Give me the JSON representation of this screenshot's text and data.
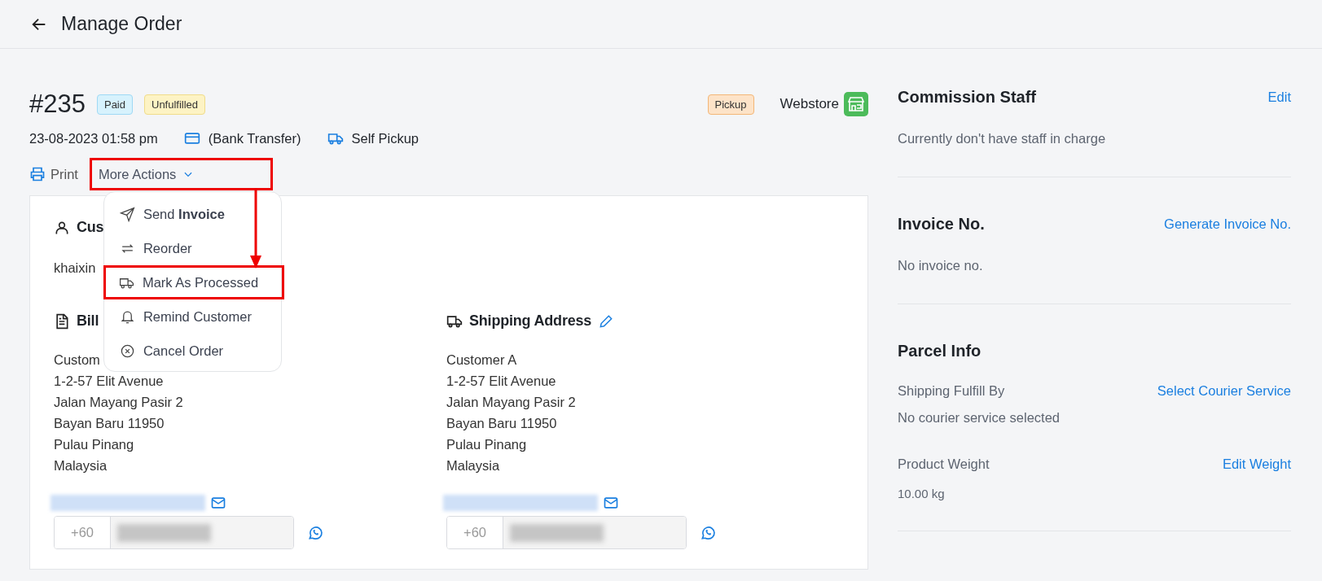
{
  "header": {
    "title": "Manage Order"
  },
  "order": {
    "number": "#235",
    "badges": [
      {
        "label": "Paid",
        "kind": "paid"
      },
      {
        "label": "Unfulfilled",
        "kind": "unfulfilled"
      }
    ],
    "date": "23-08-2023 01:58 pm",
    "payment": "(Bank Transfer)",
    "delivery": "Self Pickup",
    "method_badge": {
      "label": "Pickup",
      "kind": "pickup"
    },
    "channel": "Webstore"
  },
  "actions": {
    "print": "Print",
    "more": {
      "label": "More Actions",
      "expanded": true,
      "highlighted": true
    },
    "menu": [
      {
        "label": "Send **Invoice**",
        "highlighted": false
      },
      {
        "label": "Reorder",
        "highlighted": false
      },
      {
        "label": "Mark As Processed",
        "highlighted": true
      },
      {
        "label": "Remind Customer",
        "highlighted": false
      },
      {
        "label": "Cancel Order",
        "highlighted": false
      }
    ]
  },
  "customer": {
    "title": "Cus",
    "name": "khaixin"
  },
  "billing": {
    "title": "Bill",
    "lines": [
      "Custom",
      "1-2-57 Elit Avenue",
      "Jalan Mayang Pasir 2",
      "Bayan Baru 11950",
      "Pulau Pinang",
      "Malaysia"
    ],
    "phone_code": "+60"
  },
  "shipping": {
    "title": "Shipping Address",
    "lines": [
      "Customer A",
      "1-2-57 Elit Avenue",
      "Jalan Mayang Pasir 2",
      "Bayan Baru 11950",
      "Pulau Pinang",
      "Malaysia"
    ],
    "phone_code": "+60",
    "editable": true
  },
  "side": [
    {
      "title": "Commission Staff",
      "action": "Edit",
      "items": [
        {
          "kind": "note",
          "text": "Currently don't have staff in charge"
        }
      ]
    },
    {
      "title": "Invoice No.",
      "action": "Generate Invoice No.",
      "items": [
        {
          "kind": "note",
          "text": "No invoice no."
        }
      ]
    },
    {
      "title": "Parcel Info",
      "items": [
        {
          "kind": "row",
          "text": "Shipping Fulfill By",
          "link": "Select Courier Service"
        },
        {
          "kind": "note",
          "text": "No courier service selected"
        },
        {
          "kind": "row",
          "text": "Product Weight",
          "link": "Edit Weight"
        },
        {
          "kind": "value",
          "text": "10.00 kg"
        }
      ]
    }
  ]
}
